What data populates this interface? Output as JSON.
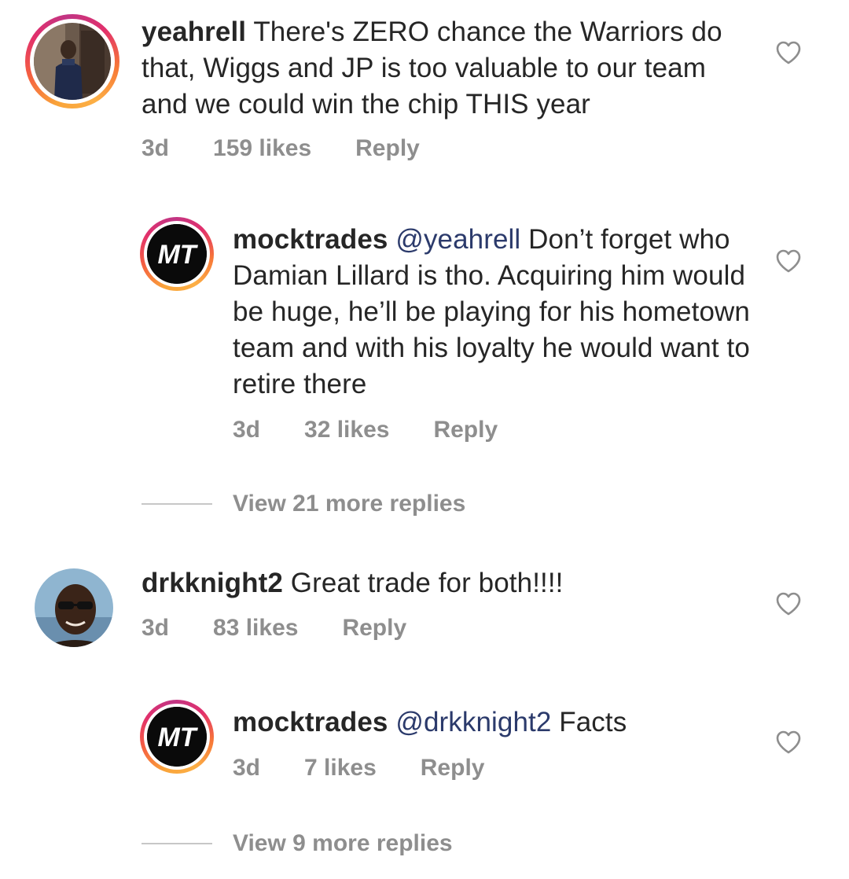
{
  "comments": [
    {
      "username": "yeahrell",
      "mention": "",
      "text": "There's ZERO chance the Warriors do that, Wiggs and JP is too valuable to our team and we could win the chip THIS year",
      "time": "3d",
      "likes": "159 likes",
      "reply_label": "Reply"
    },
    {
      "username": "mocktrades",
      "mention": "@yeahrell",
      "text": "Don’t forget who Damian Lillard is tho. Acquiring him would be huge, he’ll be playing for his hometown team and with his loyalty he would want to retire there",
      "time": "3d",
      "likes": "32 likes",
      "reply_label": "Reply"
    },
    {
      "username": "drkknight2",
      "mention": "",
      "text": "Great trade for both!!!!",
      "time": "3d",
      "likes": "83 likes",
      "reply_label": "Reply"
    },
    {
      "username": "mocktrades",
      "mention": "@drkknight2",
      "text": "Facts",
      "time": "3d",
      "likes": "7 likes",
      "reply_label": "Reply"
    }
  ],
  "view_more": [
    {
      "label": "View 21 more replies"
    },
    {
      "label": "View 9 more replies"
    }
  ],
  "logo": {
    "text": "MT"
  },
  "icons": {
    "like": "heart-outline-icon"
  },
  "colors": {
    "text": "#262626",
    "meta": "#8e8e8e",
    "mention": "#2b3a6b"
  }
}
